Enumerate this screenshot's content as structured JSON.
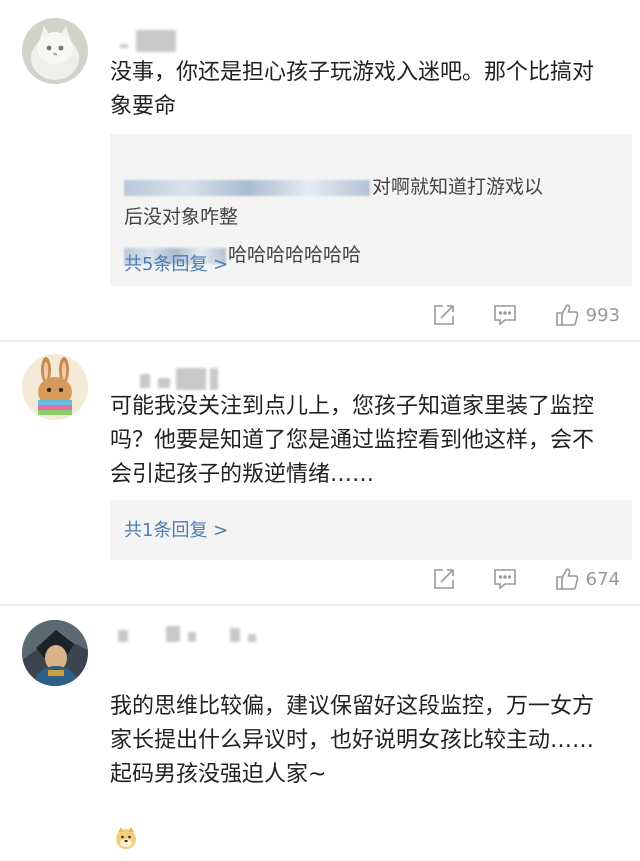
{
  "comments": [
    {
      "body": "没事，你还是担心孩子玩游戏入迷吧。那个比搞对\n象要命",
      "replies": [
        {
          "text": "对啊就知道打游戏以\n后没对象咋整"
        },
        {
          "text": "哈哈哈哈哈哈哈"
        }
      ],
      "more_replies": "共5条回复 >",
      "likes": "993"
    },
    {
      "body": "可能我没关注到点儿上，您孩子知道家里装了监控\n吗？他要是知道了您是通过监控看到他这样，会不\n会引起孩子的叛逆情绪……",
      "more_replies": "共1条回复 >",
      "likes": "674"
    },
    {
      "body": "我的思维比较偏，建议保留好这段监控，万一女方\n家长提出什么异议时，也好说明女孩比较主动……\n起码男孩没强迫人家~"
    }
  ],
  "icons": {
    "share": "share-icon",
    "comment": "comment-icon",
    "like": "thumbs-up-icon",
    "emoji": "doge-emoji-icon"
  },
  "colors": {
    "link": "#4f7bb5",
    "reply_bg": "#f4f4f4",
    "icon": "#999999"
  }
}
